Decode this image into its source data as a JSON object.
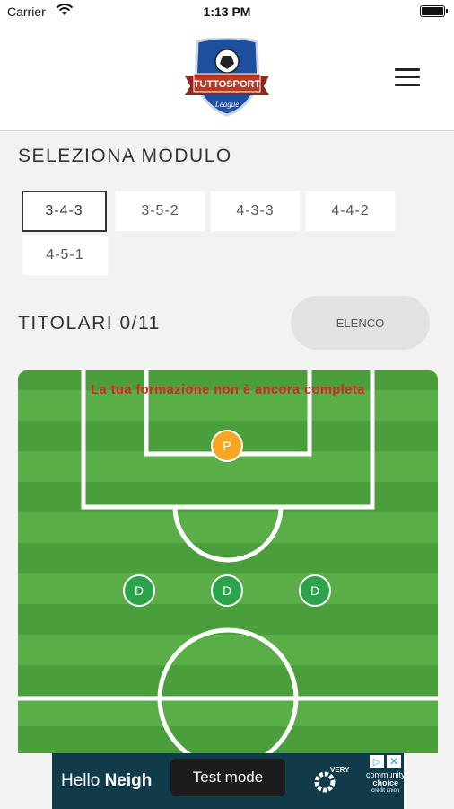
{
  "status_bar": {
    "carrier": "Carrier",
    "time": "1:13 PM"
  },
  "header": {
    "logo_top": "TUTTOSPORT",
    "logo_bottom": "League"
  },
  "module_section": {
    "title": "SELEZIONA MODULO",
    "modules": [
      "3-4-3",
      "3-5-2",
      "4-3-3",
      "4-4-2",
      "4-5-1"
    ],
    "selected": "3-4-3"
  },
  "titolari": {
    "label": "TITOLARI 0/11",
    "elenco_label": "ELENCO"
  },
  "field": {
    "warning": "La tua formazione non è ancora completa",
    "goalkeeper": "P",
    "defenders": [
      "D",
      "D",
      "D"
    ]
  },
  "ad": {
    "text_normal": "Hello ",
    "text_bold": "Neigh",
    "every": "VERY",
    "brand_line1": "community",
    "brand_line2": "choice",
    "brand_line3": "credit union",
    "test_mode": "Test mode"
  },
  "colors": {
    "pitch_dark": "#4a9e3b",
    "pitch_light": "#5aae48",
    "goalkeeper": "#f5a623",
    "defender": "#2aa34a",
    "warning": "#e02020"
  }
}
